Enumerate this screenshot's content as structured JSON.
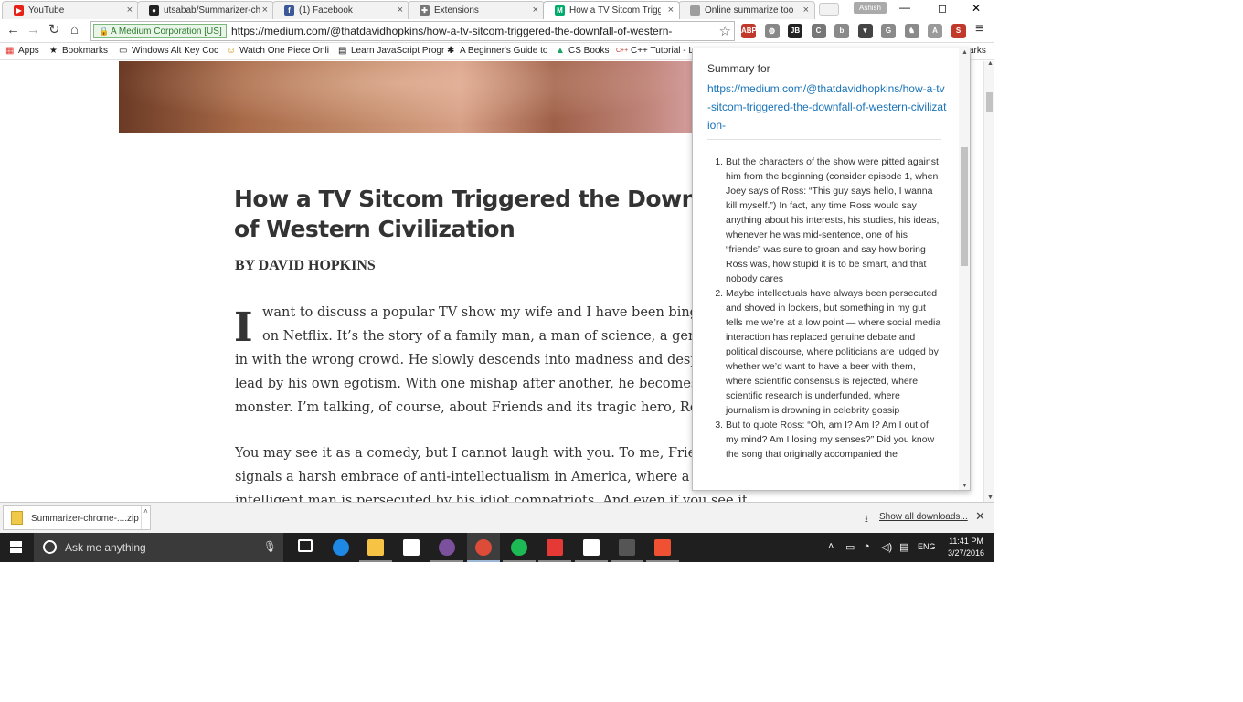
{
  "browser": {
    "tabs": [
      {
        "title": "YouTube",
        "icon": "youtube-icon",
        "color": "#e62117"
      },
      {
        "title": "utsabab/Summarizer-ch",
        "icon": "github-icon",
        "color": "#222222"
      },
      {
        "title": "(1) Facebook",
        "icon": "facebook-icon",
        "color": "#3b5998"
      },
      {
        "title": "Extensions",
        "icon": "puzzle-icon",
        "color": "#777777"
      },
      {
        "title": "How a TV Sitcom Trigge",
        "icon": "medium-icon",
        "color": "#00ab6c"
      },
      {
        "title": "Online summarize too",
        "icon": "page-icon",
        "color": "#9e9e9e"
      }
    ],
    "user_badge": "Ashish",
    "window_controls": {
      "minimize": "—",
      "maximize": "◻",
      "close": "✕"
    }
  },
  "toolbar": {
    "ev_label": "A Medium Corporation [US]",
    "url": "https://medium.com/@thatdavidhopkins/how-a-tv-sitcom-triggered-the-downfall-of-western-",
    "extensions": [
      {
        "name": "adblock-icon",
        "label": "ABP",
        "color": "#c0392b"
      },
      {
        "name": "globe-icon",
        "label": "◍",
        "color": "#888888"
      },
      {
        "name": "jb-icon",
        "label": "JB",
        "color": "#222222"
      },
      {
        "name": "cast-icon",
        "label": "C",
        "color": "#777777"
      },
      {
        "name": "ublock-icon",
        "label": "b",
        "color": "#8a8a8a"
      },
      {
        "name": "pocket-icon",
        "label": "▼",
        "color": "#444444"
      },
      {
        "name": "grammarly-icon",
        "label": "G",
        "color": "#8a8a8a"
      },
      {
        "name": "ghostery-icon",
        "label": "♞",
        "color": "#8a8a8a"
      },
      {
        "name": "angular-icon",
        "label": "A",
        "color": "#9a9a9a"
      },
      {
        "name": "summarizer-icon",
        "label": "S",
        "color": "#c0392b"
      }
    ],
    "menu_label": "≡"
  },
  "bookmarks": [
    {
      "label": "Apps",
      "icon": "apps-icon"
    },
    {
      "label": "Bookmarks",
      "icon": "star-icon"
    },
    {
      "label": "Windows Alt Key Coc",
      "icon": "page-icon"
    },
    {
      "label": "Watch One Piece Onli",
      "icon": "smiley-icon"
    },
    {
      "label": "Learn JavaScript Progr",
      "icon": "doc-icon"
    },
    {
      "label": "A Beginner's Guide to",
      "icon": "bug-icon"
    },
    {
      "label": "CS Books",
      "icon": "drive-icon"
    },
    {
      "label": "C++ Tutorial - L",
      "icon": "cpp-icon"
    }
  ],
  "bookmarks_overflow": "arks",
  "article": {
    "title": "How a TV Sitcom Triggered the Downfall of Western Civilization",
    "byline": "BY DAVID HOPKINS",
    "dropcap": "I",
    "para1": [
      "want to discuss a popular TV show my wife and I have been binge-watching",
      "on Netflix. It’s the story of a family man, a man of science, a genius who fell",
      "in with the wrong crowd. He slowly descends into madness and despair,",
      "lead by his own egotism. With one mishap after another, he becomes a",
      "monster. I’m talking, of course, about Friends and its tragic hero, Ross"
    ],
    "para2": [
      "You may see it as a comedy, but I cannot laugh with you. To me, Friends",
      "signals a harsh embrace of anti-intellectualism in America, where a gifted",
      "intelligent man is persecuted by his idiot compatriots. And even if you see it"
    ]
  },
  "popup": {
    "heading": "Summary for",
    "link": "https://medium.com/@thatdavidhopkins/how-a-tv-sitcom-triggered-the-downfall-of-western-civilization-",
    "items": [
      "But the characters of the show were pitted against him from the beginning (consider episode 1, when Joey says of Ross: “This guy says hello, I wanna kill myself.”) In fact, any time Ross would say anything about his interests, his studies, his ideas, whenever he was mid-sentence, one of his “friends” was sure to groan and say how boring Ross was, how stupid it is to be smart, and that nobody cares",
      "Maybe intellectuals have always been persecuted and shoved in lockers, but something in my gut tells me we’re at a low point — where social media interaction has replaced genuine debate and political discourse, where politicians are judged by whether we’d want to have a beer with them, where scientific consensus is rejected, where scientific research is underfunded, where journalism is drowning in celebrity gossip",
      "But to quote Ross: “Oh, am I? Am I? Am I out of my mind? Am I losing my senses?” Did you know the song that originally accompanied the"
    ]
  },
  "downloads": {
    "file": "Summarizer-chrome-....zip",
    "show_all": "Show all downloads...",
    "close": "✕"
  },
  "taskbar": {
    "search_placeholder": "Ask me anything",
    "apps": [
      {
        "name": "task-view-icon",
        "color": "#ffffff"
      },
      {
        "name": "edge-icon",
        "color": "#1e88e5"
      },
      {
        "name": "file-explorer-icon",
        "color": "#f6c344"
      },
      {
        "name": "store-icon",
        "color": "#ffffff"
      },
      {
        "name": "viber-icon",
        "color": "#7b519d"
      },
      {
        "name": "chrome-icon",
        "color": "#dd4b39"
      },
      {
        "name": "spotify-icon",
        "color": "#1db954"
      },
      {
        "name": "tiles-icon",
        "color": "#e53935"
      },
      {
        "name": "calendar-icon",
        "color": "#ffffff"
      },
      {
        "name": "sublime-icon",
        "color": "#555555"
      },
      {
        "name": "git-icon",
        "color": "#f05133"
      }
    ],
    "tray_lang": "ENG",
    "time": "11:41 PM",
    "date": "3/27/2016"
  }
}
